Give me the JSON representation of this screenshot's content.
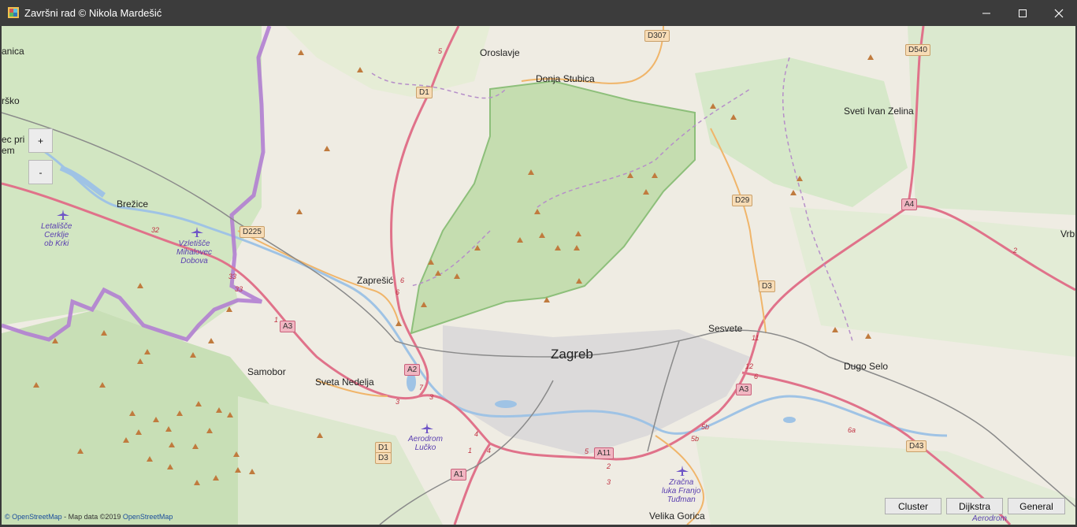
{
  "window": {
    "title": "Završni rad © Nikola Mardešić"
  },
  "window_controls": {
    "minimize": "—",
    "maximize": "☐",
    "close": "✕"
  },
  "zoom": {
    "in_label": "+",
    "out_label": "-"
  },
  "buttons": {
    "cluster": "Cluster",
    "dijkstra": "Dijkstra",
    "general": "General"
  },
  "attribution": {
    "osm": "© OpenStreetMap",
    "sep": " - Map data ©2019 ",
    "osm2": "OpenStreetMap"
  },
  "places": {
    "zagreb": "Zagreb",
    "sesvete": "Sesvete",
    "dugo_selo": "Dugo Selo",
    "velika_gorica": "Velika Gorica",
    "samobor": "Samobor",
    "sveta_nedelja": "Sveta Nedelja",
    "zapresic": "Zaprešić",
    "brezice": "Brežice",
    "oroslavje": "Oroslavje",
    "donja_stubica": "Donja Stubica",
    "sveti_ivan_zelina": "Sveti Ivan Zelina",
    "vrb": "Vrb",
    "anica": "anica",
    "rsko": "rško",
    "ec_pri": "ec pri",
    "em": "em"
  },
  "airports": {
    "cerklje": "Letališče\nCerklje\nob Krki",
    "dobova": "Vzletišče\nMihalovec\nDobova",
    "lucko": "Aerodrom\nLučko",
    "tudman": "Zračna\nluka Franjo\nTuđman",
    "aerodrom": "Aerodrom"
  },
  "road_shields": {
    "d307": "D307",
    "d540": "D540",
    "d1": "D1",
    "d29": "D29",
    "a4": "A4",
    "d225": "D225",
    "d3": "D3",
    "a3_west": "A3",
    "a2": "A2",
    "a3_east": "A3",
    "d1_south": "D1",
    "d3_south": "D3",
    "a11": "A11",
    "a1": "A1",
    "d43": "D43"
  },
  "road_numbers": {
    "n5": "5",
    "n32": "32",
    "n33a": "33",
    "n33b": "33",
    "n6a": "6",
    "n6b": "6",
    "n1": "1",
    "n3a": "3",
    "n7": "7",
    "n3b": "3",
    "n4a": "4",
    "n4b": "4",
    "n1b": "1",
    "n5b": "5",
    "n2": "2",
    "n3c": "3",
    "n5bb": "5b",
    "n5bc": "5b",
    "n11": "11",
    "n12": "12",
    "n6c": "6",
    "n6a2": "6a",
    "n2b": "2"
  },
  "icons": {
    "airport": "airplane-icon",
    "peak": "peak-icon"
  }
}
